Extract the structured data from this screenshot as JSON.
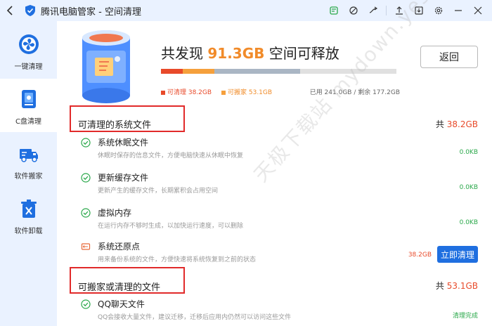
{
  "window": {
    "title": "腾讯电脑管家 - 空间清理",
    "titlebar_icons": [
      "shirt-icon",
      "feather-icon",
      "shuffle-icon",
      "upload-icon",
      "download-icon",
      "gear-icon",
      "minimize-icon",
      "close-icon"
    ]
  },
  "sidebar": {
    "items": [
      {
        "label": "一键清理",
        "icon": "fan-icon",
        "active": false
      },
      {
        "label": "C盘清理",
        "icon": "drive-icon",
        "active": true
      },
      {
        "label": "软件搬家",
        "icon": "truck-icon",
        "active": false
      },
      {
        "label": "软件卸载",
        "icon": "trash-icon",
        "active": false
      }
    ]
  },
  "summary": {
    "headline_prefix": "共发现 ",
    "headline_value": "91.3GB",
    "headline_suffix": " 空间可释放",
    "return_label": "返回",
    "usage": {
      "cleanable_fraction": 0.094,
      "movable_fraction": 0.132,
      "used_other_fraction": 0.364,
      "colors": {
        "cleanable": "#e84a2a",
        "movable": "#f5a03c",
        "used": "#aab6c4",
        "free": "#e0e0e0"
      }
    },
    "legend": {
      "cleanable": "可清理 38.2GB",
      "movable": "可搬家 53.1GB",
      "disk": "已用 241.0GB / 剩余 177.2GB"
    }
  },
  "sections": [
    {
      "title": "可清理的系统文件",
      "total_prefix": "共 ",
      "total_value": "38.2GB",
      "items": [
        {
          "name": "系统休眠文件",
          "desc": "休眠时保存的信息文件，方便电脑快速从休眠中恢复",
          "size": "0.0KB",
          "icon": "check-circle-icon"
        },
        {
          "name": "更新缓存文件",
          "desc": "更新产生的缓存文件，长期累积会占用空间",
          "size": "0.0KB",
          "icon": "check-circle-icon"
        },
        {
          "name": "虚拟内存",
          "desc": "在运行内存不够时生成，以加快运行速度，可以删除",
          "size": "0.0KB",
          "icon": "check-circle-icon"
        },
        {
          "name": "系统还原点",
          "desc": "用来备份系统的文件，方便快速将系统恢复到之前的状态",
          "size": "38.2GB",
          "icon": "restore-icon",
          "action": "立即清理"
        }
      ]
    },
    {
      "title": "可搬家或清理的文件",
      "total_prefix": "共 ",
      "total_value": "53.1GB",
      "items": [
        {
          "name": "QQ聊天文件",
          "desc": "QQ会接收大量文件，建议迁移，迁移后应用内仍然可以访问这些文件",
          "size": "清理完成",
          "icon": "check-circle-icon"
        }
      ]
    }
  ],
  "watermark": "天极下载站 mydown.yesky.com"
}
